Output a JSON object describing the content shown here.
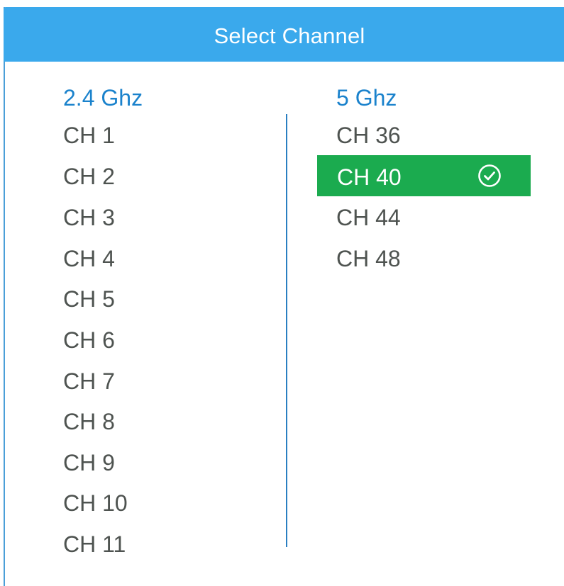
{
  "dialog": {
    "title": "Select Channel"
  },
  "band_24": {
    "heading": "2.4 Ghz",
    "channels": [
      "CH 1",
      "CH 2",
      "CH 3",
      "CH 4",
      "CH 5",
      "CH 6",
      "CH 7",
      "CH 8",
      "CH 9",
      "CH 10",
      "CH 11"
    ]
  },
  "band_5": {
    "heading": "5 Ghz",
    "channels": [
      "CH 36",
      "CH 40",
      "CH 44",
      "CH 48"
    ],
    "selected": "CH 40"
  },
  "colors": {
    "header_bg": "#3aa9ec",
    "heading_text": "#1a82cc",
    "channel_text": "#4e5350",
    "selected_bg": "#1bab4f"
  },
  "icons": {
    "selected_check": "check-circle-icon"
  }
}
